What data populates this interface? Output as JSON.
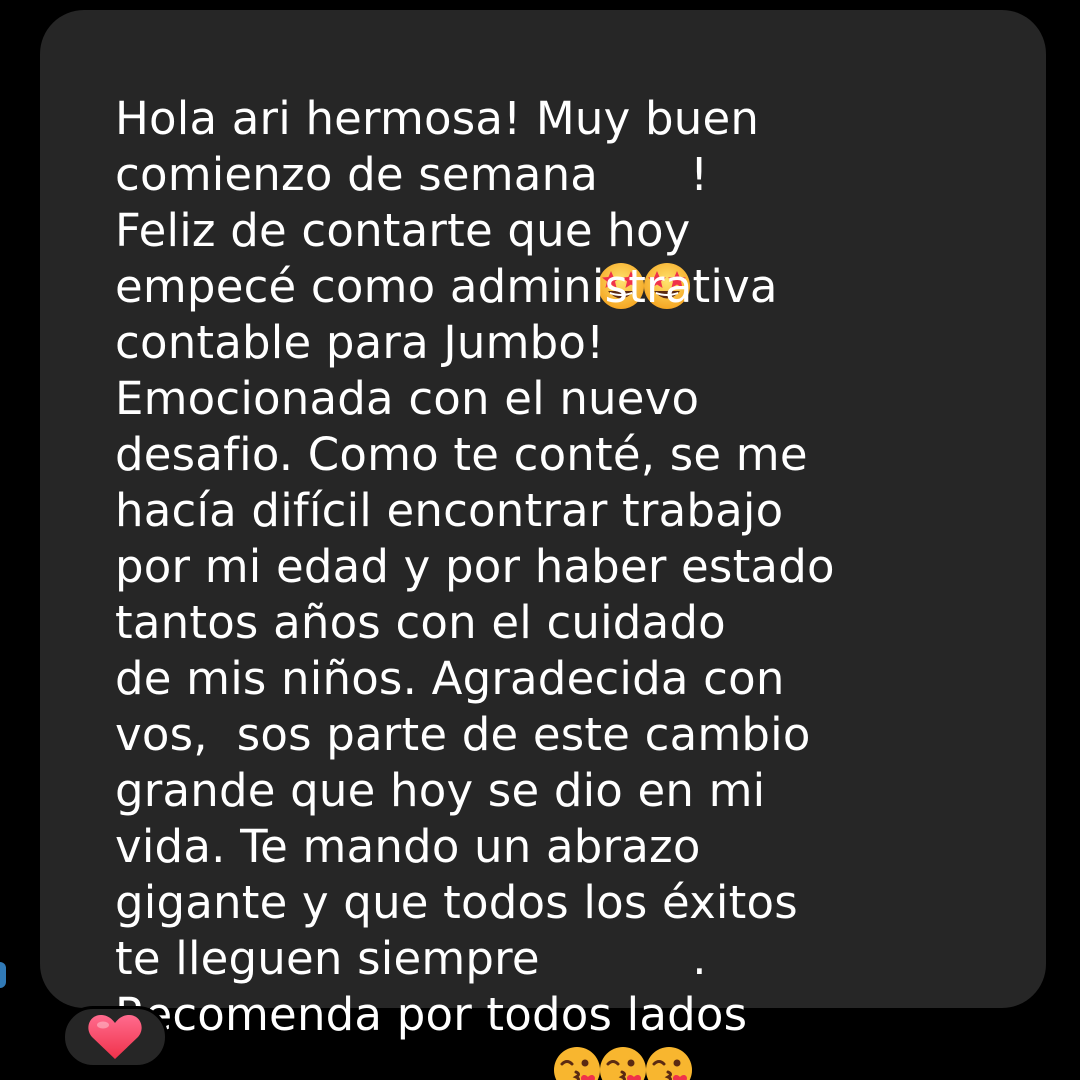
{
  "message": {
    "lines": [
      {
        "text": "Hola ari hermosa! Muy buen"
      },
      {
        "text": "comienzo de semana",
        "emojis": [
          "star-struck-emoji",
          "star-struck-emoji"
        ],
        "after": "!"
      },
      {
        "text": "Feliz de contarte que hoy"
      },
      {
        "text": "empecé como administrativa"
      },
      {
        "text": "contable para Jumbo!"
      },
      {
        "text": "Emocionada con el nuevo"
      },
      {
        "text": "desafio. Como te conté, se me"
      },
      {
        "text": "hacía difícil encontrar trabajo"
      },
      {
        "text": "por mi edad y por haber estado"
      },
      {
        "text": "tantos años con el cuidado"
      },
      {
        "text": "de mis niños. Agradecida con"
      },
      {
        "text": "vos,  sos parte de este cambio"
      },
      {
        "text": "grande que hoy se dio en mi"
      },
      {
        "text": "vida. Te mando un abrazo"
      },
      {
        "text": "gigante y que todos los éxitos"
      },
      {
        "text": "te lleguen siempre ",
        "emojis": [
          "kissing-heart-emoji",
          "kissing-heart-emoji",
          "kissing-heart-emoji"
        ],
        "after": "."
      },
      {
        "text": "Recomenda por todos lados"
      }
    ]
  },
  "reaction": {
    "icon": "red-heart-emoji"
  },
  "colors": {
    "background": "#000000",
    "bubble": "#262626",
    "text": "#ffffff",
    "heart": "#ff4f7a"
  }
}
